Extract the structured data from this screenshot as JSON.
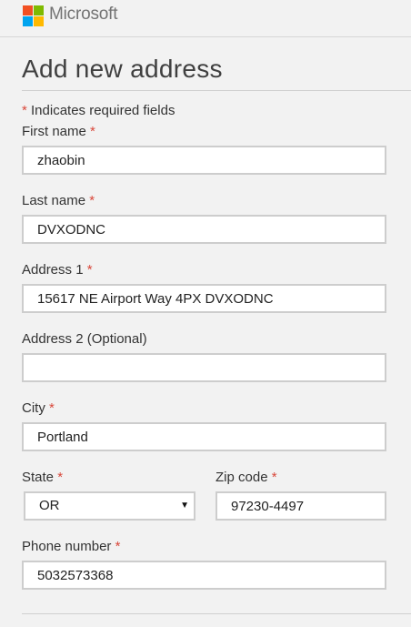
{
  "header": {
    "brand": "Microsoft",
    "logo_colors": [
      "#f25022",
      "#7fba00",
      "#00a4ef",
      "#ffb900"
    ]
  },
  "page": {
    "title": "Add new address",
    "required_note": "Indicates required fields",
    "asterisk": "*"
  },
  "form": {
    "first_name": {
      "label": "First name",
      "value": "zhaobin"
    },
    "last_name": {
      "label": "Last name",
      "value": "DVXODNC"
    },
    "address1": {
      "label": "Address 1",
      "value": "15617 NE Airport Way 4PX DVXODNC"
    },
    "address2": {
      "label": "Address 2 (Optional)",
      "value": ""
    },
    "city": {
      "label": "City",
      "value": "Portland"
    },
    "state": {
      "label": "State",
      "value": "OR",
      "caret_icon": "▼"
    },
    "zip": {
      "label": "Zip code",
      "value": "97230-4497"
    },
    "phone": {
      "label": "Phone number",
      "value": "5032573368"
    }
  }
}
